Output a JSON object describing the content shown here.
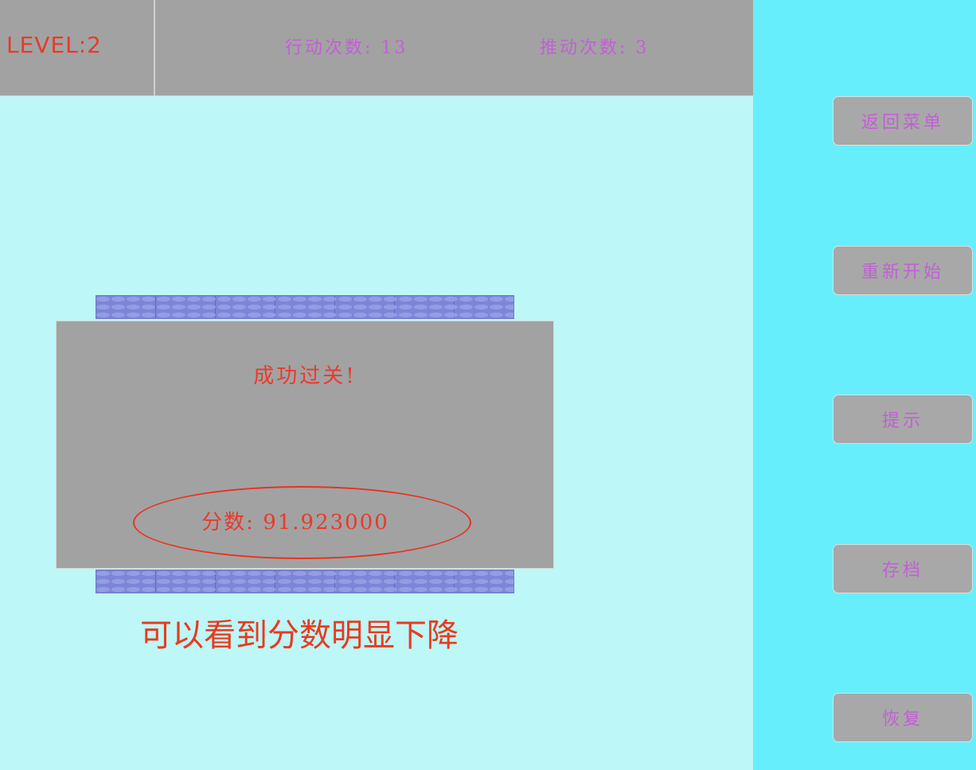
{
  "header": {
    "level": "LEVEL:2",
    "moves": "行动次数: 13",
    "pushes": "推动次数: 3"
  },
  "sidebar": {
    "buttons": [
      "返回菜单",
      "重新开始",
      "提示",
      "存档",
      "恢复"
    ]
  },
  "dialog": {
    "title": "成功过关!",
    "score": "分数: 91.923000"
  },
  "annotation": {
    "caption": "可以看到分数明显下降"
  },
  "colors": {
    "game_background": "#bdf7f7",
    "sidebar_background": "#67eefc",
    "panel_gray": "#a2a2a2",
    "text_red": "#e83a2c",
    "text_purple": "#c25fd6",
    "wall_blue": "#7d86d6"
  }
}
